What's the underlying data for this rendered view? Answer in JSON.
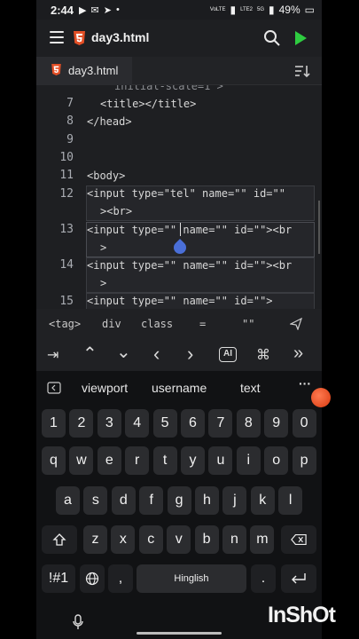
{
  "status_bar": {
    "time": "2:44",
    "battery": "49%",
    "net_label_1": "VoLTE",
    "net_label_2": "LTE2",
    "net_label_3": "5G"
  },
  "app_bar": {
    "file_title": "day3.html",
    "icons": [
      "menu-icon",
      "html5-icon",
      "search-icon",
      "run-icon"
    ]
  },
  "tabs": [
    {
      "label": "day3.html",
      "active": true
    }
  ],
  "editor": {
    "partial_top": "initial-scale=1\">",
    "lines": [
      {
        "num": "7",
        "text": "<title></title>"
      },
      {
        "num": "8",
        "text": "</head>"
      },
      {
        "num": "9",
        "text": ""
      },
      {
        "num": "10",
        "text": ""
      },
      {
        "num": "11",
        "text": "<body>"
      },
      {
        "num": "12",
        "text": "<input type=\"tel\" name=\"\" id=\"\"",
        "wrap": "><br>"
      },
      {
        "num": "13",
        "text": "<input type=\"\" name=\"\" id=\"\"><br",
        "wrap": ">"
      },
      {
        "num": "14",
        "text": "<input type=\"\" name=\"\" id=\"\"><br",
        "wrap": ">"
      },
      {
        "num": "15",
        "text": "<input type=\"\" name=\"\" id=\"\">"
      }
    ]
  },
  "snippet_bar": [
    "<tag>",
    "div",
    "class",
    "=",
    "\"\""
  ],
  "keys_bar": {
    "tab": "⇥",
    "up": "⌃",
    "down": "⌄",
    "left": "‹",
    "right": "›",
    "ai": "AI",
    "cmd": "⌘",
    "skip": "»"
  },
  "keyboard": {
    "suggestions": [
      "viewport",
      "username",
      "text"
    ],
    "more": "···",
    "row_numbers": [
      "1",
      "2",
      "3",
      "4",
      "5",
      "6",
      "7",
      "8",
      "9",
      "0"
    ],
    "row1": [
      "q",
      "w",
      "e",
      "r",
      "t",
      "y",
      "u",
      "i",
      "o",
      "p"
    ],
    "row2": [
      "a",
      "s",
      "d",
      "f",
      "g",
      "h",
      "j",
      "k",
      "l"
    ],
    "row3": [
      "z",
      "x",
      "c",
      "v",
      "b",
      "n",
      "m"
    ],
    "symbols": "!#1",
    "comma": ",",
    "space": "Hinglish",
    "period": "."
  },
  "watermark": "InShOt"
}
